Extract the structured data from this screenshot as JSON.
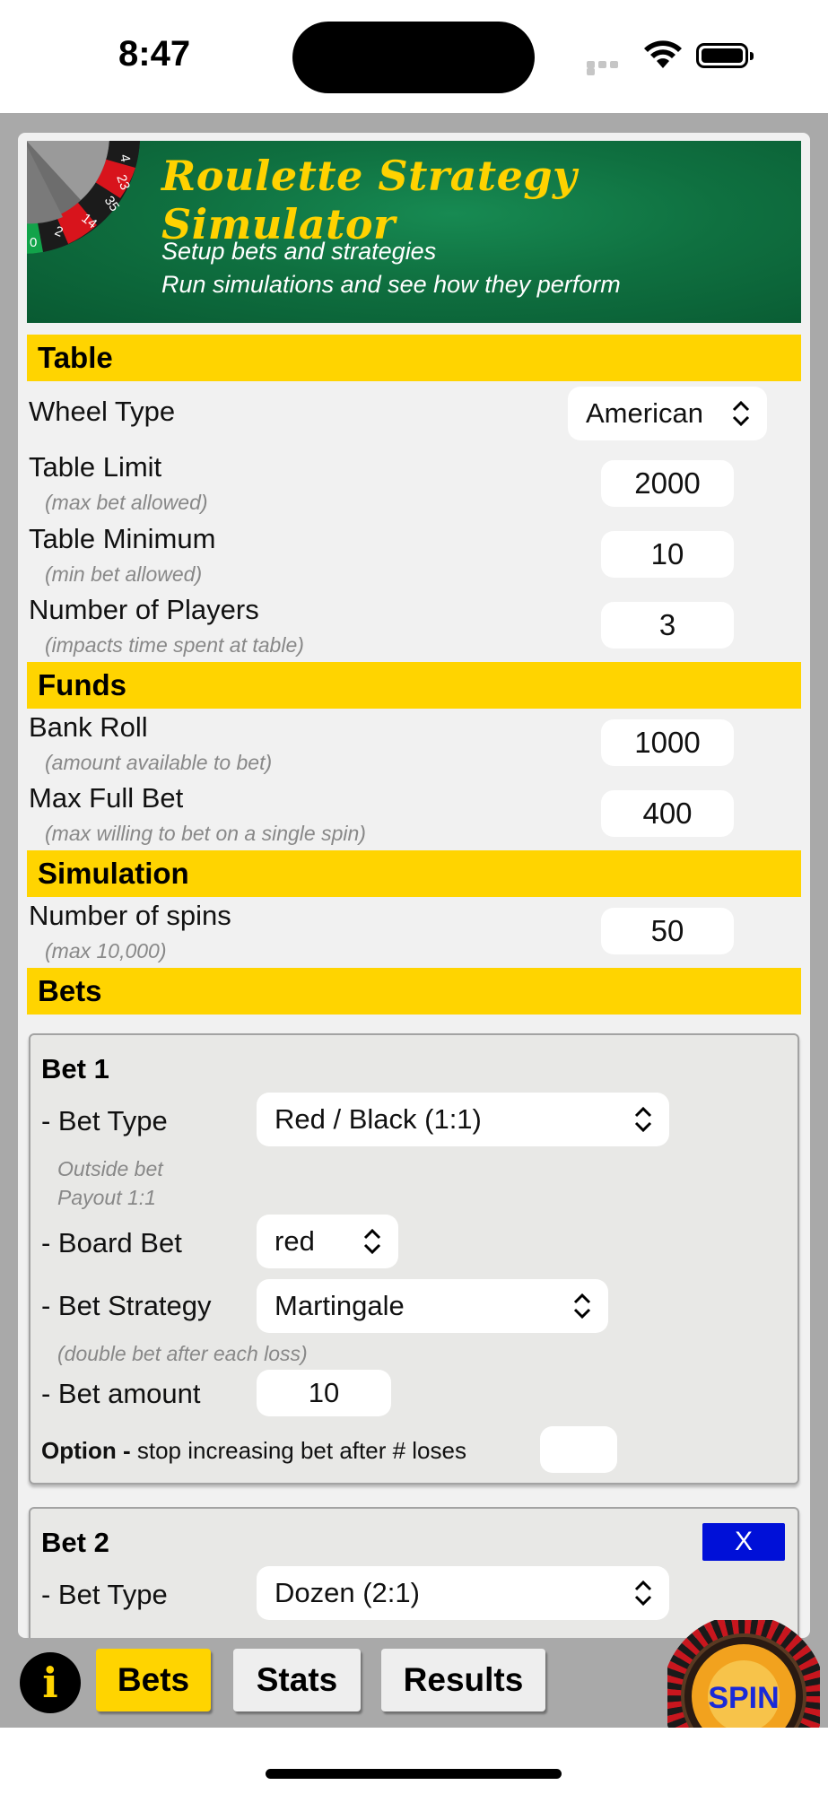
{
  "status_bar": {
    "time": "8:47"
  },
  "banner": {
    "title": "Roulette Strategy Simulator",
    "line1": "Setup bets and strategies",
    "line2": "Run simulations and see how they perform",
    "wheel_numbers": [
      "4",
      "23",
      "35",
      "14",
      "2",
      "0"
    ]
  },
  "table": {
    "header": "Table",
    "wheel_type": {
      "label": "Wheel Type",
      "value": "American"
    },
    "table_limit": {
      "label": "Table Limit",
      "hint": "(max bet allowed)",
      "value": "2000"
    },
    "table_minimum": {
      "label": "Table Minimum",
      "hint": "(min bet allowed)",
      "value": "10"
    },
    "players": {
      "label": "Number of Players",
      "hint": "(impacts time spent at table)",
      "value": "3"
    }
  },
  "funds": {
    "header": "Funds",
    "bank_roll": {
      "label": "Bank Roll",
      "hint": "(amount available to bet)",
      "value": "1000"
    },
    "max_full_bet": {
      "label": "Max Full Bet",
      "hint": "(max willing to bet on a single spin)",
      "value": "400"
    }
  },
  "simulation": {
    "header": "Simulation",
    "spins": {
      "label": "Number of spins",
      "hint": "(max 10,000)",
      "value": "50"
    }
  },
  "bets_section": {
    "header": "Bets",
    "bet1": {
      "title": "Bet 1",
      "type_label": "- Bet Type",
      "type_value": "Red / Black (1:1)",
      "type_hint1": "Outside bet",
      "type_hint2": "Payout 1:1",
      "board_label": "- Board Bet",
      "board_value": "red",
      "strategy_label": "- Bet Strategy",
      "strategy_value": "Martingale",
      "strategy_hint": "(double bet after each loss)",
      "amount_label": "- Bet amount",
      "amount_value": "10",
      "option_bold": "Option -",
      "option_text": " stop increasing bet after # loses",
      "option_value": ""
    },
    "bet2": {
      "title": "Bet 2",
      "remove_label": "X",
      "type_label": "- Bet Type",
      "type_value": "Dozen (2:1)"
    }
  },
  "tabs": {
    "info": "i",
    "bets": "Bets",
    "stats": "Stats",
    "results": "Results",
    "spin": "SPIN"
  },
  "colors": {
    "accent_yellow": "#ffd400",
    "felt_green": "#0f7040",
    "remove_blue": "#0010d8",
    "frame_gray": "#a9a9a9"
  }
}
